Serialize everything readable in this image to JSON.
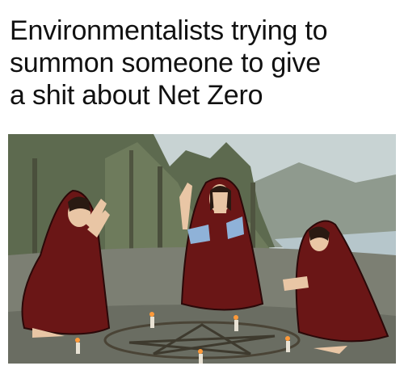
{
  "caption": {
    "line1": "Environmentalists trying to",
    "line2": "summon someone to give",
    "line3": "a shit about Net Zero"
  },
  "scene": {
    "description_icon": "summoning-ritual-illustration",
    "robe_color": "#6b1414",
    "sky_color": "#c9d6d8",
    "forest_color": "#5f6e52",
    "ground_color": "#7b7f74",
    "candle_count": 5
  }
}
